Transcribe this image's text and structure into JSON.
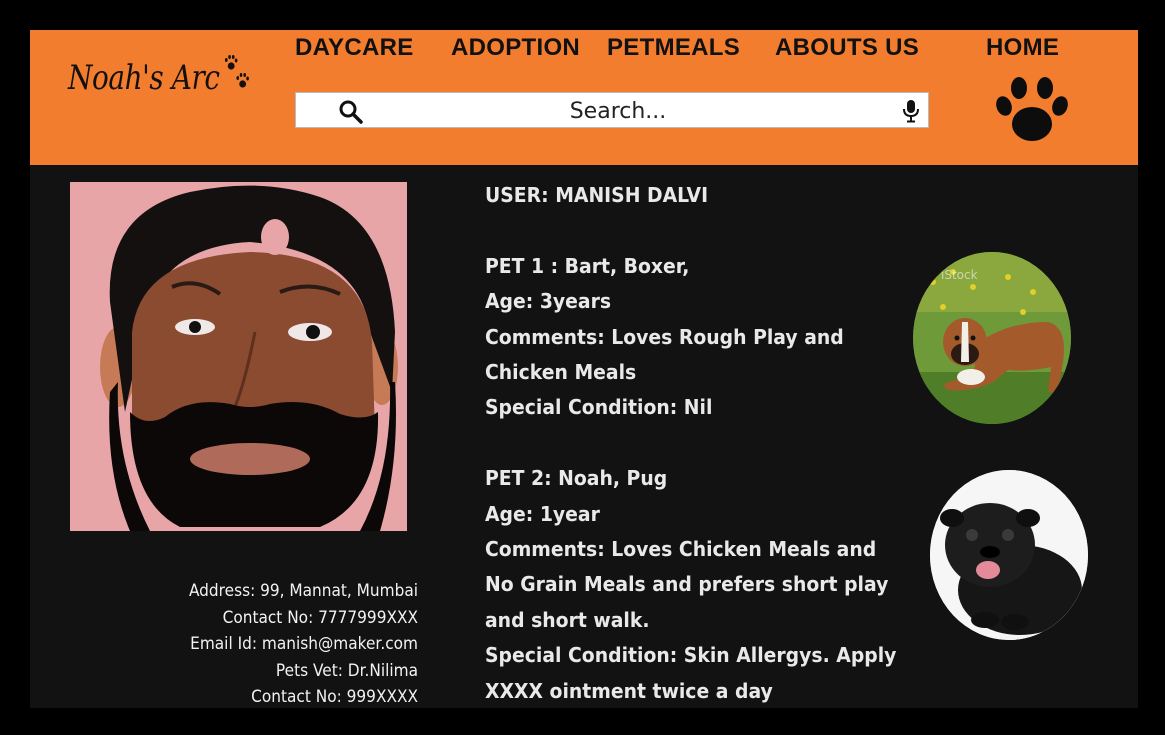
{
  "brand": {
    "name": "Noah's Arc"
  },
  "nav": {
    "items": [
      {
        "label": "DAYCARE"
      },
      {
        "label": "ADOPTION"
      },
      {
        "label": "PETMEALS"
      },
      {
        "label": "ABOUTS US"
      },
      {
        "label": "HOME"
      }
    ]
  },
  "search": {
    "placeholder": "Search..."
  },
  "user": {
    "heading": "USER: MANISH DALVI",
    "contact": [
      "Address: 99, Mannat, Mumbai",
      "Contact No: 7777999XXX",
      "Email Id: manish@maker.com",
      "Pets Vet: Dr.Nilima",
      "Contact No: 999XXXX"
    ]
  },
  "pets": [
    {
      "lines": [
        "PET 1 : Bart, Boxer,",
        "Age: 3years",
        "Comments: Loves Rough Play and",
        "Chicken Meals",
        "Special Condition: Nil"
      ],
      "photo_watermark": "iStock"
    },
    {
      "lines": [
        "PET 2: Noah, Pug",
        "Age: 1year",
        "Comments: Loves Chicken Meals and",
        "No Grain Meals and prefers short play",
        "and short walk.",
        "Special Condition: Skin Allergys. Apply",
        "XXXX ointment twice a day"
      ]
    }
  ],
  "colors": {
    "header_bg": "#f27d2e",
    "page_bg": "#121212",
    "text": "#e9e9e9",
    "avatar_bg": "#e7a5a8"
  }
}
